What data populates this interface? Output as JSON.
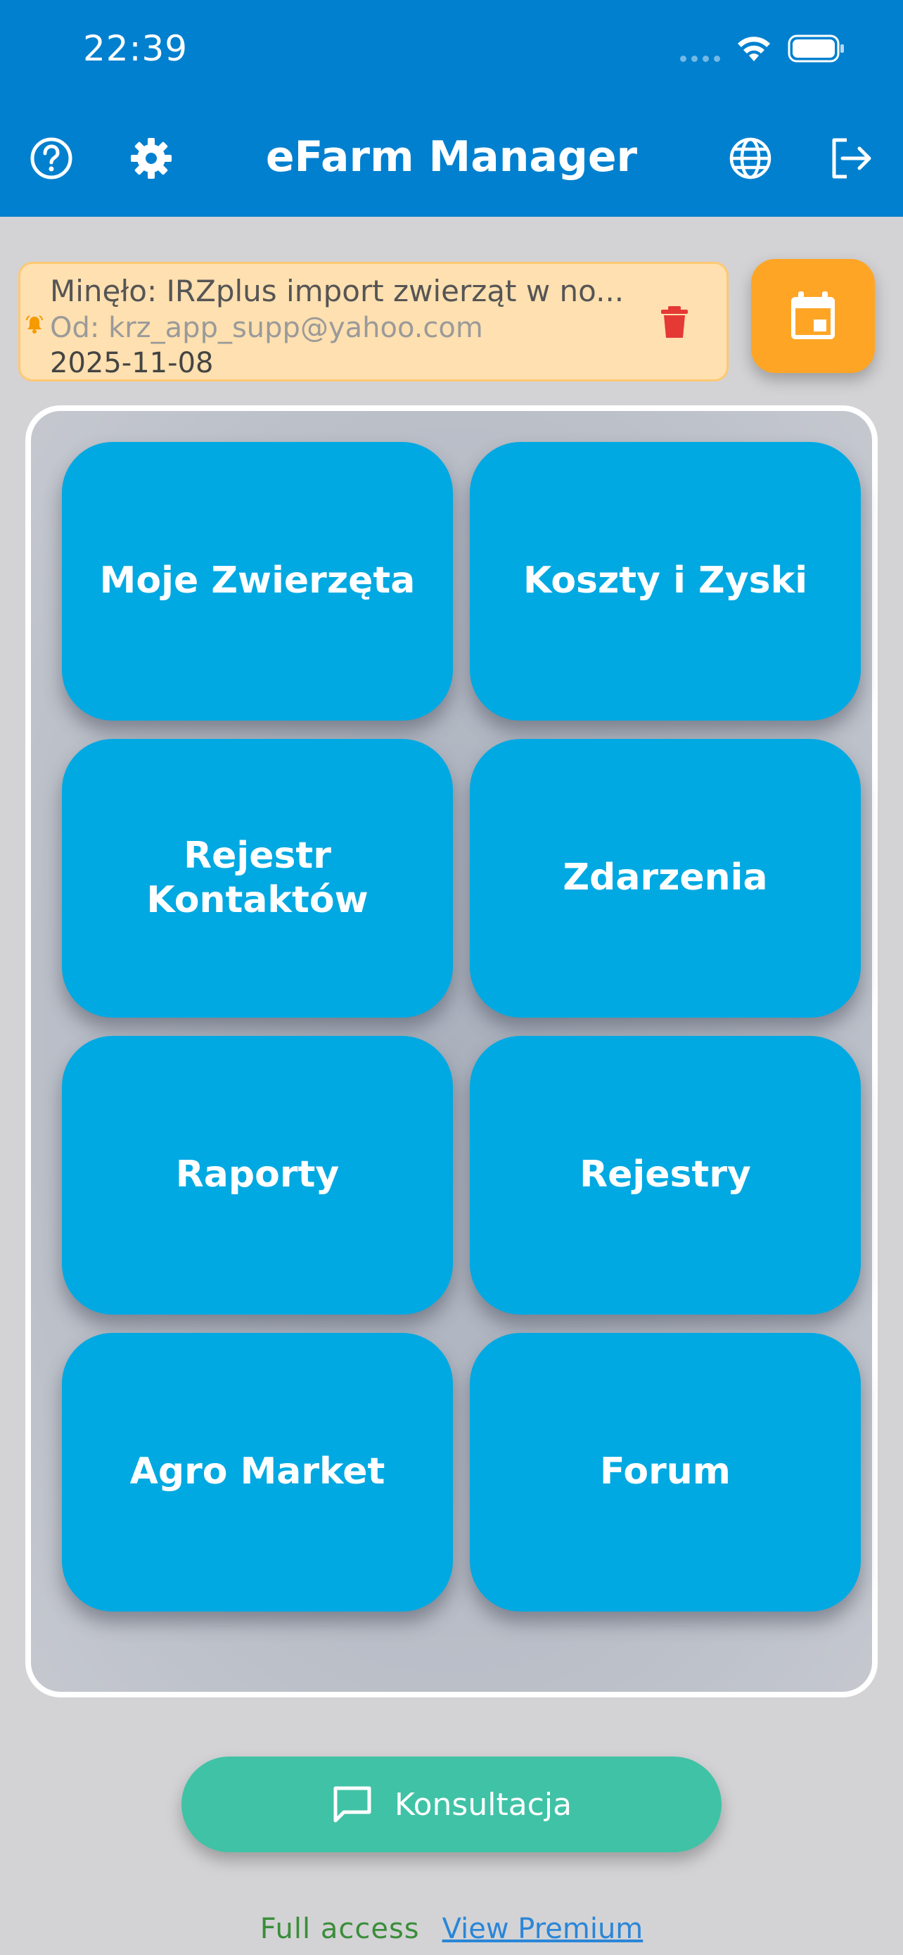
{
  "status_bar": {
    "time": "22:39"
  },
  "header": {
    "title": "eFarm Manager"
  },
  "notification": {
    "title": "Minęło: IRZplus import zwierząt w no...",
    "from": "Od: krz_app_supp@yahoo.com",
    "date": "2025-11-08"
  },
  "menu": {
    "tiles": [
      {
        "label": "Moje Zwierzęta"
      },
      {
        "label": "Koszty i Zyski"
      },
      {
        "label": "Rejestr Kontaktów"
      },
      {
        "label": "Zdarzenia"
      },
      {
        "label": "Raporty"
      },
      {
        "label": "Rejestry"
      },
      {
        "label": "Agro Market"
      },
      {
        "label": "Forum"
      }
    ]
  },
  "consult_button": {
    "label": "Konsultacja"
  },
  "footer": {
    "access": "Full access",
    "premium_link": "View Premium"
  },
  "colors": {
    "header": "#0180cf",
    "tile": "#00a9e2",
    "calendar_button": "#ffa526",
    "consult_button": "#40c2a6",
    "notification_bg": "#ffe0b0",
    "delete": "#e53935"
  },
  "icons": [
    "help-icon",
    "settings-gear-icon",
    "globe-icon",
    "logout-icon",
    "bell-icon",
    "trash-icon",
    "calendar-icon",
    "chat-icon",
    "wifi-icon",
    "battery-icon"
  ]
}
